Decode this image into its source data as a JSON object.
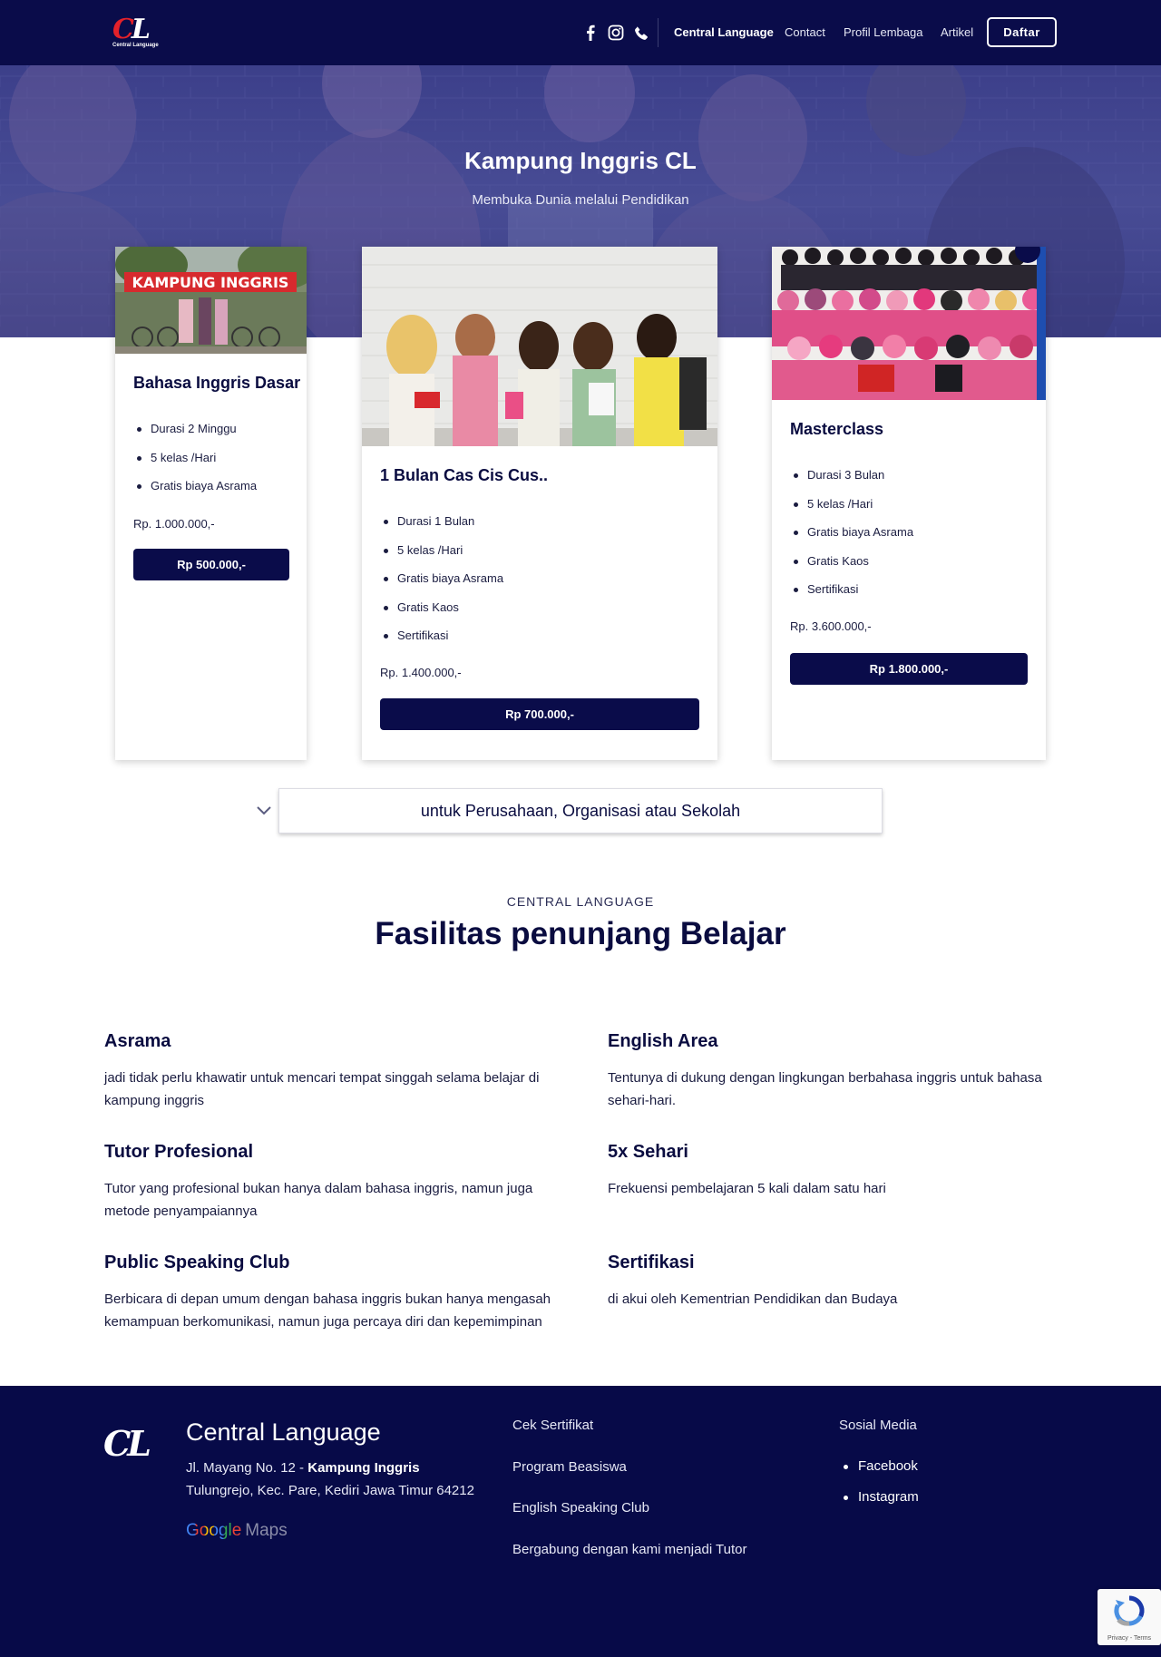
{
  "header": {
    "logo_text": "CL",
    "logo_sub": "Central Language",
    "social_icons": [
      "facebook-icon",
      "instagram-icon",
      "phone-icon"
    ],
    "nav": [
      "Central Language",
      "Contact",
      "Profil Lembaga",
      "Artikel"
    ],
    "cta": "Daftar"
  },
  "hero": {
    "title": "Kampung Inggris CL",
    "subtitle": "Membuka Dunia melalui Pendidikan",
    "image_sign_text": "KAMPUNG INGGRIS"
  },
  "cards": [
    {
      "title": "Bahasa Inggris Dasar",
      "features": [
        "Durasi 2 Minggu",
        "5 kelas /Hari",
        "Gratis biaya Asrama"
      ],
      "price": "Rp. 1.000.000,-",
      "button": "Rp 500.000,-"
    },
    {
      "title": "1 Bulan Cas Cis Cus..",
      "features": [
        "Durasi 1 Bulan",
        "5 kelas /Hari",
        "Gratis biaya Asrama",
        "Gratis Kaos",
        "Sertifikasi"
      ],
      "price": "Rp. 1.400.000,-",
      "button": "Rp 700.000,-"
    },
    {
      "title": "Masterclass",
      "features": [
        "Durasi 3 Bulan",
        "5 kelas /Hari",
        "Gratis biaya Asrama",
        "Gratis Kaos",
        "Sertifikasi"
      ],
      "price": "Rp. 3.600.000,-",
      "button": "Rp 1.800.000,-"
    }
  ],
  "accordion": {
    "label": "untuk Perusahaan, Organisasi atau Sekolah"
  },
  "facilities": {
    "kicker": "CENTRAL LANGUAGE",
    "title": "Fasilitas penunjang Belajar",
    "items": [
      {
        "title": "Asrama",
        "desc": "jadi tidak perlu khawatir untuk mencari tempat singgah selama belajar di kampung inggris"
      },
      {
        "title": "English Area",
        "desc": "Tentunya di dukung dengan lingkungan berbahasa inggris untuk bahasa sehari-hari."
      },
      {
        "title": "Tutor Profesional",
        "desc": "Tutor yang profesional bukan hanya dalam bahasa inggris, namun juga metode penyampaiannya"
      },
      {
        "title": "5x Sehari",
        "desc": "Frekuensi pembelajaran 5 kali dalam satu hari"
      },
      {
        "title": "Public Speaking Club",
        "desc": "Berbicara di depan umum dengan bahasa inggris bukan hanya mengasah kemampuan berkomunikasi, namun juga percaya diri dan kepemimpinan"
      },
      {
        "title": "Sertifikasi",
        "desc": "di akui oleh Kementrian Pendidikan dan Budaya"
      }
    ]
  },
  "footer": {
    "brand": "Central Language",
    "address_line1": "Jl. Mayang No. 12 - ",
    "address_bold": "Kampung Inggris",
    "address_line2": "Tulungrejo, Kec. Pare, Kediri Jawa Timur 64212",
    "maps_google": "Google",
    "maps_label": "Maps",
    "links": [
      "Cek Sertifikat",
      "Program Beasiswa",
      "English Speaking Club",
      "Bergabung dengan kami menjadi Tutor"
    ],
    "social_heading": "Sosial Media",
    "social_links": [
      "Facebook",
      "Instagram"
    ]
  },
  "recaptcha": {
    "text": "Privacy - Terms"
  },
  "colors": {
    "navy": "#0a0c4a",
    "hero_overlay": "#3c3f8a",
    "logo_red": "#e3212a"
  }
}
